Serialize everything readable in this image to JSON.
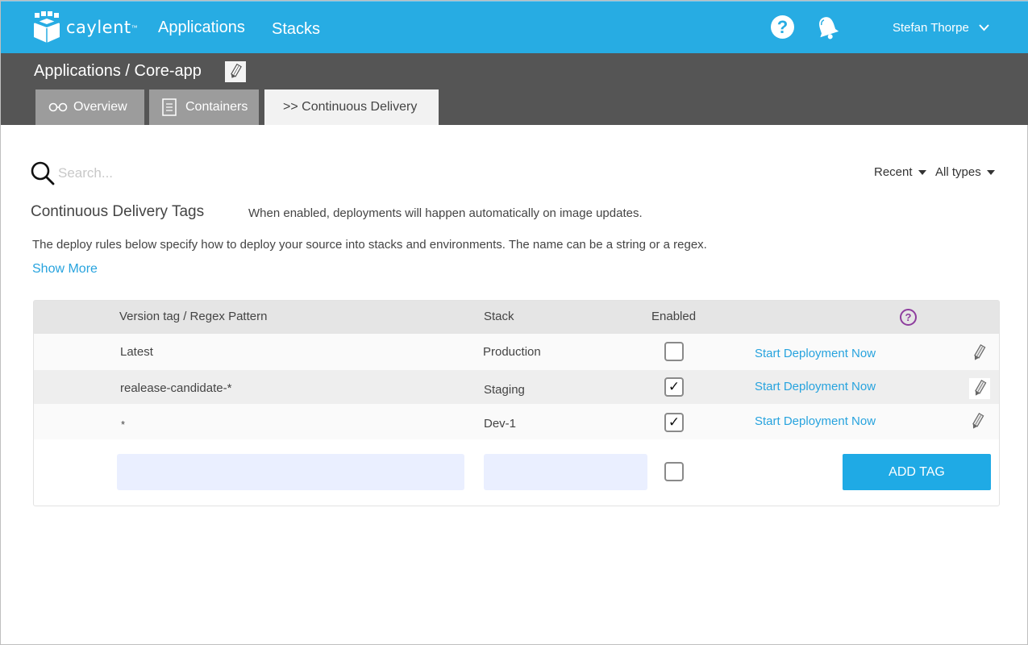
{
  "app": {
    "logo_text": "caylent",
    "logo_tm": "™"
  },
  "nav": {
    "items": [
      {
        "label": "Applications"
      },
      {
        "label": "Stacks"
      }
    ],
    "user_name": "Stefan Thorpe",
    "help_glyph": "?"
  },
  "header": {
    "breadcrumb": "Applications / Core-app",
    "tabs": [
      {
        "label": "Overview",
        "icon": "glasses-icon"
      },
      {
        "label": "Containers",
        "icon": "document-icon"
      },
      {
        "label": ">> Continuous Delivery",
        "active": true
      }
    ]
  },
  "search": {
    "placeholder": "Search...",
    "value": ""
  },
  "filters": {
    "recent_label": "Recent",
    "types_label": "All types"
  },
  "section": {
    "title": "Continuous Delivery Tags",
    "note": "When enabled, deployments will happen automatically on image updates.",
    "description": "The deploy rules below specify how to deploy your source into stacks and environments. The name can be a string or a regex.",
    "show_more": "Show More"
  },
  "table": {
    "columns": {
      "tag": "Version tag / Regex Pattern",
      "stack": "Stack",
      "enabled": "Enabled",
      "help_glyph": "?"
    },
    "rows": [
      {
        "tag": "Latest",
        "stack": "Production",
        "enabled": false,
        "action": "Start Deployment Now"
      },
      {
        "tag": "realease-candidate-*",
        "stack": "Staging",
        "enabled": true,
        "action": "Start Deployment Now"
      },
      {
        "tag": "*",
        "stack": "Dev-1",
        "enabled": true,
        "action": "Start Deployment Now"
      }
    ],
    "new_row": {
      "tag_value": "",
      "stack_value": "",
      "enabled": false,
      "add_label": "ADD TAG"
    }
  },
  "colors": {
    "topbar": "#27ace3",
    "subheader": "#555555",
    "link": "#27a3de",
    "button": "#1faae5",
    "help_accent": "#8e3d9e"
  }
}
